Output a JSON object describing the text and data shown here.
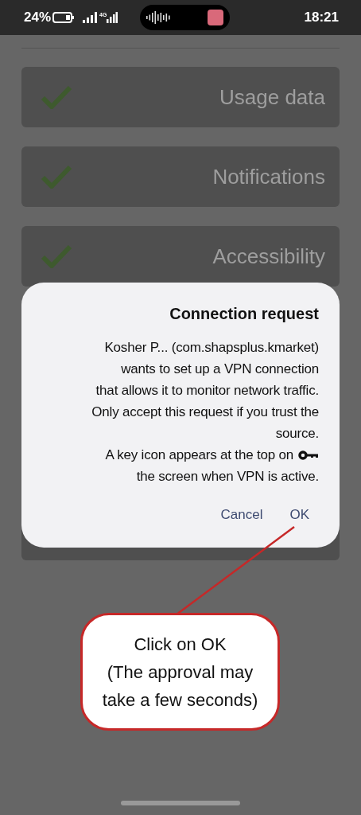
{
  "status_bar": {
    "battery": "24%",
    "network": "4G",
    "time": "18:21"
  },
  "permissions": [
    {
      "label": "Usage data",
      "checked": true
    },
    {
      "label": "Notifications",
      "checked": true
    },
    {
      "label": "Accessibility",
      "checked": true
    }
  ],
  "dialog": {
    "title": "Connection request",
    "body_lines": [
      "Kosher P... (com.shapsplus.kmarket)",
      "wants to set up a VPN connection",
      "that allows it to monitor network traffic.",
      "Only accept this request if you trust the",
      "source."
    ],
    "notice_start": "A key icon appears at the top on",
    "notice_end": "the screen when VPN is active.",
    "buttons": [
      "Cancel",
      "OK"
    ]
  },
  "callout": {
    "lines": [
      "Click on OK",
      "(The approval may",
      "take a few seconds)"
    ]
  }
}
